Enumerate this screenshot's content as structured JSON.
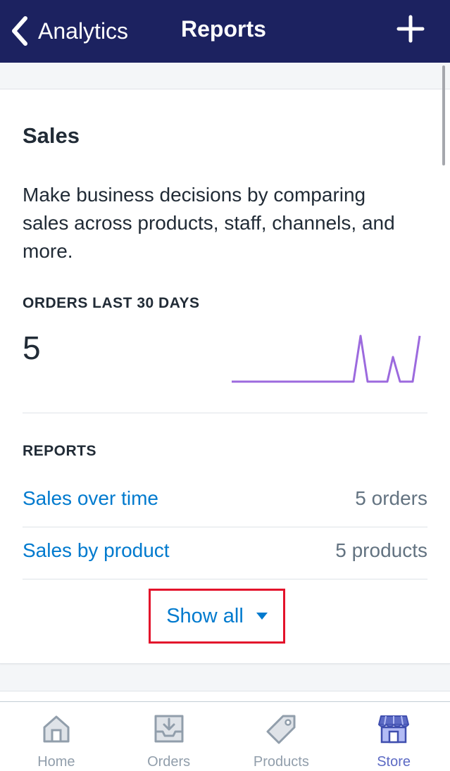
{
  "navbar": {
    "back_label": "Analytics",
    "title": "Reports",
    "back_icon": "chevron-left-icon",
    "add_icon": "plus-icon"
  },
  "card": {
    "title": "Sales",
    "description": "Make business decisions by comparing sales across products, staff, channels, and more.",
    "metric_label": "ORDERS LAST 30 DAYS",
    "metric_value": "5",
    "sparkline_color": "#9c6ade",
    "reports_label": "REPORTS",
    "reports": [
      {
        "label": "Sales over time",
        "count": "5 orders"
      },
      {
        "label": "Sales by product",
        "count": "5 products"
      }
    ],
    "show_all_label": "Show all"
  },
  "tabbar": {
    "tabs": [
      {
        "label": "Home",
        "icon": "home-icon",
        "active": false
      },
      {
        "label": "Orders",
        "icon": "orders-icon",
        "active": false
      },
      {
        "label": "Products",
        "icon": "tag-icon",
        "active": false
      },
      {
        "label": "Store",
        "icon": "store-icon",
        "active": true
      }
    ]
  },
  "colors": {
    "navbar_bg": "#1c2260",
    "link": "#007ace",
    "active_tab": "#5c6ac4",
    "inactive_tab": "#919eab",
    "highlight_border": "#e3122b"
  }
}
